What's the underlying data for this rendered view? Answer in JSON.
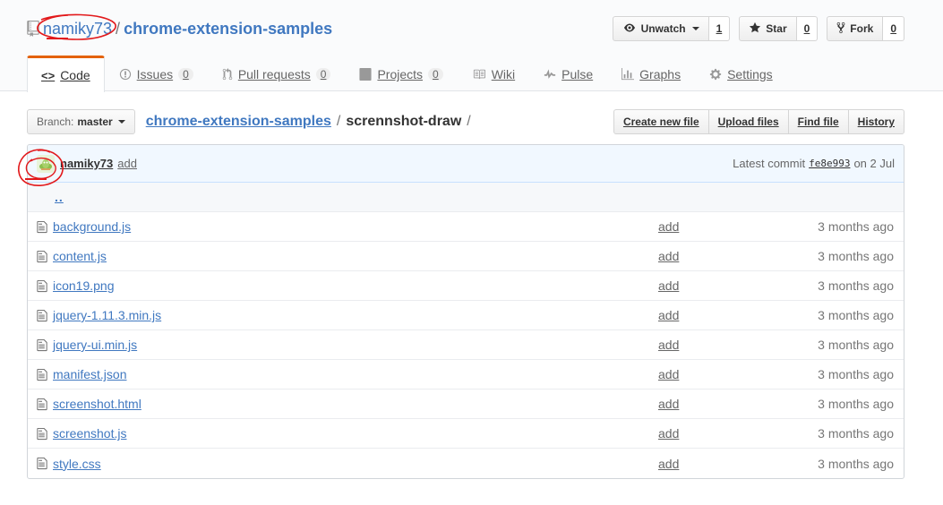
{
  "repo": {
    "owner": "namiky73",
    "separator": "/",
    "name": "chrome-extension-samples"
  },
  "actions": {
    "watch": {
      "label": "Unwatch",
      "count": "1"
    },
    "star": {
      "label": "Star",
      "count": "0"
    },
    "fork": {
      "label": "Fork",
      "count": "0"
    }
  },
  "tabs": [
    {
      "label": "Code",
      "icon": "code-icon"
    },
    {
      "label": "Issues",
      "count": "0",
      "icon": "issue-icon"
    },
    {
      "label": "Pull requests",
      "count": "0",
      "icon": "pull-request-icon"
    },
    {
      "label": "Projects",
      "count": "0",
      "icon": "project-icon"
    },
    {
      "label": "Wiki",
      "icon": "book-icon"
    },
    {
      "label": "Pulse",
      "icon": "pulse-icon"
    },
    {
      "label": "Graphs",
      "icon": "graph-icon"
    },
    {
      "label": "Settings",
      "icon": "gear-icon"
    }
  ],
  "filenav": {
    "branch_label": "Branch:",
    "branch_value": "master",
    "breadcrumb_root": "chrome-extension-samples",
    "breadcrumb_sep": "/",
    "breadcrumb_current": "scrennshot-draw",
    "breadcrumb_trailing": "/",
    "buttons": [
      "Create new file",
      "Upload files",
      "Find file",
      "History"
    ]
  },
  "commit": {
    "author": "namiky73",
    "message": "add",
    "latest_label": "Latest commit",
    "sha": "fe8e993",
    "date": "on 2 Jul"
  },
  "up_link": "..",
  "files": [
    {
      "name": "background.js",
      "message": "add",
      "age": "3 months ago"
    },
    {
      "name": "content.js",
      "message": "add",
      "age": "3 months ago"
    },
    {
      "name": "icon19.png",
      "message": "add",
      "age": "3 months ago"
    },
    {
      "name": "jquery-1.11.3.min.js",
      "message": "add",
      "age": "3 months ago"
    },
    {
      "name": "jquery-ui.min.js",
      "message": "add",
      "age": "3 months ago"
    },
    {
      "name": "manifest.json",
      "message": "add",
      "age": "3 months ago"
    },
    {
      "name": "screenshot.html",
      "message": "add",
      "age": "3 months ago"
    },
    {
      "name": "screenshot.js",
      "message": "add",
      "age": "3 months ago"
    },
    {
      "name": "style.css",
      "message": "add",
      "age": "3 months ago"
    }
  ],
  "colors": {
    "link": "#4078c0",
    "selected_tab_border": "#e36209",
    "commit_bg": "#f1f8ff",
    "annotation": "#e2191b"
  }
}
